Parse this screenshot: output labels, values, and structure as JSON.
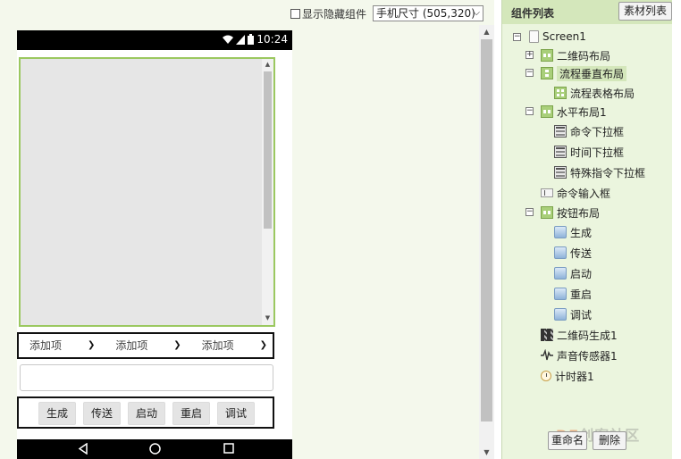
{
  "viewer": {
    "show_hidden_label": "显示隐藏组件",
    "size_select": "手机尺寸 (505,320)"
  },
  "phone": {
    "time": "10:24",
    "dropdowns": [
      "添加项",
      "添加项",
      "添加项"
    ],
    "buttons": [
      "生成",
      "传送",
      "启动",
      "重启",
      "调试"
    ]
  },
  "components": {
    "title": "组件列表",
    "assets_button": "素材列表",
    "tree": [
      {
        "label": "Screen1",
        "icon": "screen-icon"
      },
      {
        "label": "二维码布局",
        "icon": "horizontal-layout-icon"
      },
      {
        "label": "流程垂直布局",
        "icon": "vertical-layout-icon"
      },
      {
        "label": "流程表格布局",
        "icon": "table-layout-icon"
      },
      {
        "label": "水平布局1",
        "icon": "horizontal-layout-icon"
      },
      {
        "label": "命令下拉框",
        "icon": "spinner-icon"
      },
      {
        "label": "时间下拉框",
        "icon": "spinner-icon"
      },
      {
        "label": "特殊指令下拉框",
        "icon": "spinner-icon"
      },
      {
        "label": "命令输入框",
        "icon": "textbox-icon"
      },
      {
        "label": "按钮布局",
        "icon": "horizontal-layout-icon"
      },
      {
        "label": "生成",
        "icon": "button-icon"
      },
      {
        "label": "传送",
        "icon": "button-icon"
      },
      {
        "label": "启动",
        "icon": "button-icon"
      },
      {
        "label": "重启",
        "icon": "button-icon"
      },
      {
        "label": "调试",
        "icon": "button-icon"
      },
      {
        "label": "二维码生成1",
        "icon": "qr-code-icon"
      },
      {
        "label": "声音传感器1",
        "icon": "sound-sensor-icon"
      },
      {
        "label": "计时器1",
        "icon": "clock-icon"
      }
    ],
    "rename_button": "重命名",
    "delete_button": "删除"
  },
  "watermark": {
    "brand": "DF",
    "rest": "创客社区"
  },
  "colors": {
    "panel_header": "#d4e7bb",
    "layout_border": "#9bc860",
    "selected": "#d4e7bb"
  }
}
